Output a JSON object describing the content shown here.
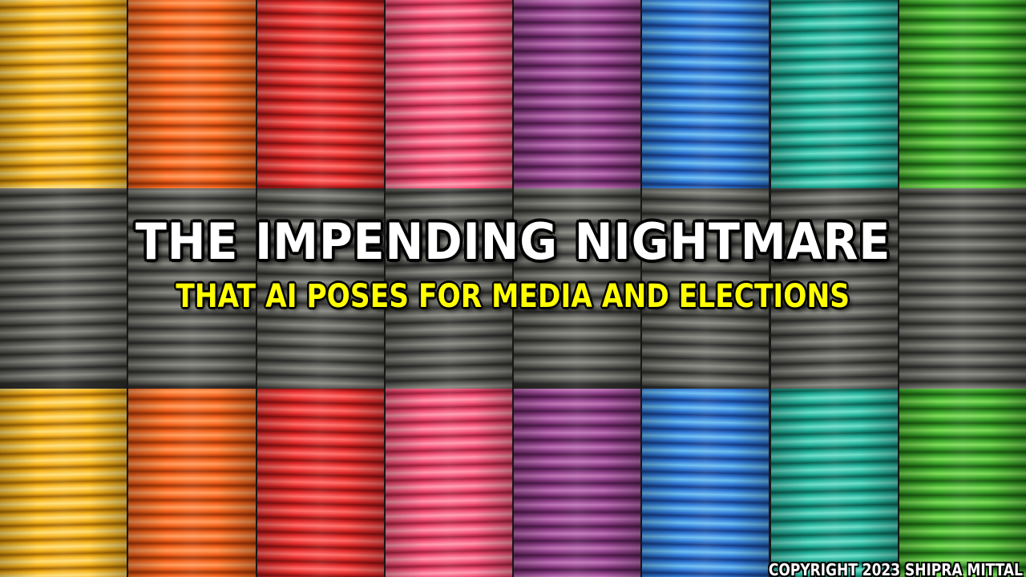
{
  "background": {
    "columns": [
      {
        "name": "yellow",
        "color": "#f6b21a",
        "dark": "#a56a05",
        "light": "#ffe07a"
      },
      {
        "name": "orange",
        "color": "#f4621a",
        "dark": "#a13507",
        "light": "#ff9d5e"
      },
      {
        "name": "red",
        "color": "#e52b2b",
        "dark": "#8f1010",
        "light": "#ff6f6a"
      },
      {
        "name": "pink",
        "color": "#f24e74",
        "dark": "#a5213f",
        "light": "#ff9ab0"
      },
      {
        "name": "purple",
        "color": "#8c3c86",
        "dark": "#4f1b4c",
        "light": "#c176b9"
      },
      {
        "name": "blue",
        "color": "#2f7ad8",
        "dark": "#163e8a",
        "light": "#6fc0f2"
      },
      {
        "name": "teal",
        "color": "#1fae98",
        "dark": "#0b6455",
        "light": "#6fe0cb"
      },
      {
        "name": "green",
        "color": "#3aa42a",
        "dark": "#1b5f10",
        "light": "#82de5a"
      }
    ],
    "middle_band": {
      "color": "#5a5a56",
      "dark": "#2c2c2a",
      "light": "#8a8a84"
    }
  },
  "title": {
    "line1": "THE IMPENDING NIGHTMARE",
    "line2": "THAT AI POSES FOR MEDIA AND ELECTIONS"
  },
  "copyright": "COPYRIGHT 2023 SHIPRA MITTAL"
}
